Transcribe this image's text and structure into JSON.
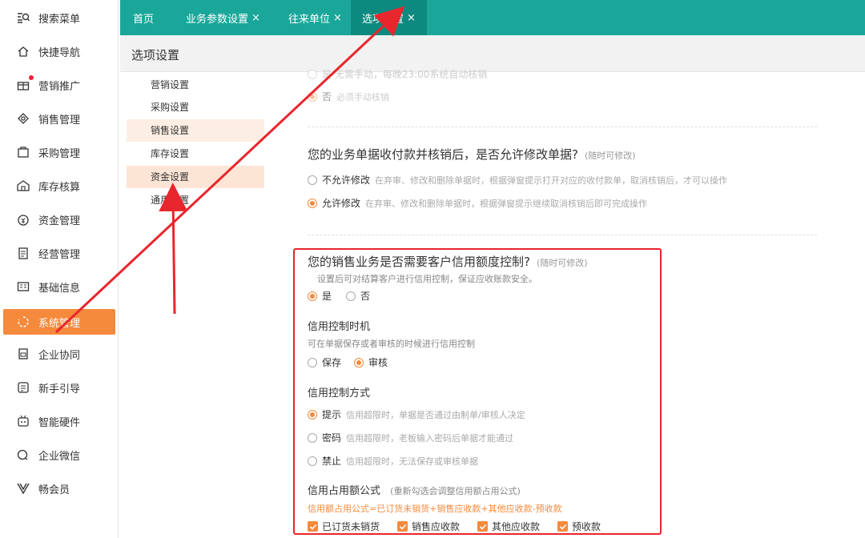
{
  "leftnav": {
    "items": [
      {
        "label": "搜索菜单",
        "icon": "menu-search-icon"
      },
      {
        "label": "快捷导航",
        "icon": "home-icon"
      },
      {
        "label": "营销推广",
        "icon": "gift-icon"
      },
      {
        "label": "销售管理",
        "icon": "sales-icon"
      },
      {
        "label": "采购管理",
        "icon": "bag-icon"
      },
      {
        "label": "库存核算",
        "icon": "warehouse-icon"
      },
      {
        "label": "资金管理",
        "icon": "money-icon"
      },
      {
        "label": "经营管理",
        "icon": "clipboard-icon"
      },
      {
        "label": "基础信息",
        "icon": "id-card-icon"
      },
      {
        "label": "系统管理",
        "icon": "system-icon"
      },
      {
        "label": "企业协同",
        "icon": "collab-icon"
      },
      {
        "label": "新手引导",
        "icon": "guide-icon"
      },
      {
        "label": "智能硬件",
        "icon": "hardware-icon"
      },
      {
        "label": "企业微信",
        "icon": "wechat-icon"
      },
      {
        "label": "畅会员",
        "icon": "vip-icon"
      }
    ],
    "active_index": 9
  },
  "tabs": [
    {
      "label": "首页",
      "closable": false
    },
    {
      "label": "业务参数设置",
      "closable": true
    },
    {
      "label": "往来单位",
      "closable": true
    },
    {
      "label": "选项设置",
      "closable": true
    }
  ],
  "page": {
    "title": "选项设置"
  },
  "subnav": [
    "营销设置",
    "采购设置",
    "销售设置",
    "库存设置",
    "资金设置",
    "通用设置"
  ],
  "top_faded": {
    "opt1": "是 无需手动，每晚23:00系统自动核销",
    "opt2_label": "否",
    "opt2_desc": "必须手动核销"
  },
  "section_modify": {
    "question": "您的业务单据收付款并核销后，是否允许修改单据?",
    "hint": "(随时可修改)",
    "opt1_label": "不允许修改",
    "opt1_desc": "在弃审、修改和删除单据时，根据弹窗提示打开对应的收付款单，取消核销后，才可以操作",
    "opt2_label": "允许修改",
    "opt2_desc": "在弃审、修改和删除单据时，根据弹窗提示继续取消核销后即可完成操作"
  },
  "section_credit": {
    "question": "您的销售业务是否需要客户信用额度控制?",
    "hint": "(随时可修改)",
    "sub": "设置后可对结算客户进行信用控制，保证应收账款安全。",
    "yes": "是",
    "no": "否",
    "timing_title": "信用控制时机",
    "timing_note": "可在单据保存或者审核的时候进行信用控制",
    "timing_save": "保存",
    "timing_audit": "审核",
    "mode_title": "信用控制方式",
    "mode1_label": "提示",
    "mode1_desc": "信用超限时，单据是否通过由制单/审核人决定",
    "mode2_label": "密码",
    "mode2_desc": "信用超限时，老板输入密码后单据才能通过",
    "mode3_label": "禁止",
    "mode3_desc": "信用超限时，无法保存或审核单据",
    "formula_title": "信用占用额公式",
    "formula_hint": "(重新勾选会调整信用额占用公式)",
    "formula_text": "信用额占用公式=已订货未销货+销售应收款+其他应收款-预收款",
    "checks": [
      "已订货未销货",
      "销售应收款",
      "其他应收款",
      "预收款"
    ]
  },
  "colors": {
    "accent": "#f58a3c",
    "topbar": "#1aa79a",
    "highlight_box": "#e8262d"
  }
}
